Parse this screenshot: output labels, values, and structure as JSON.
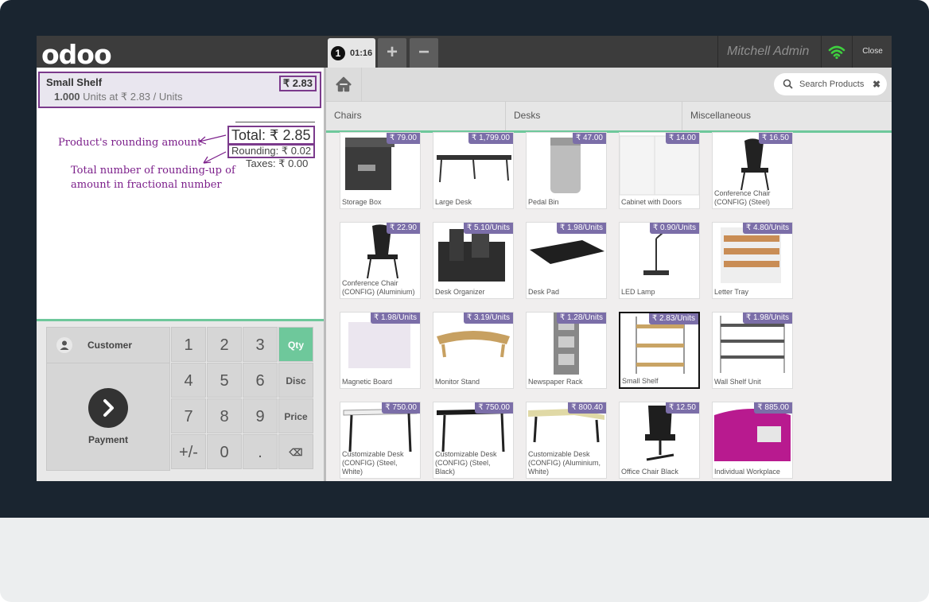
{
  "brand": {
    "logo": "odoo"
  },
  "header": {
    "order_number": "1",
    "order_time": "01:16",
    "add_label": "+",
    "remove_label": "−",
    "user": "Mitchell Admin",
    "close_label": "Close"
  },
  "order": {
    "line": {
      "name": "Small Shelf",
      "price": "₹ 2.83",
      "qty": "1.000",
      "detail": "Units at ₹ 2.83 / Units"
    },
    "total": "Total: ₹ 2.85",
    "rounding": "Rounding: ₹ 0.02",
    "taxes": "Taxes: ₹ 0.00"
  },
  "annotations": {
    "rounding_note": "Product's rounding amount",
    "total_note_1": "Total number of rounding-up of",
    "total_note_2": "amount in fractional number"
  },
  "pad": {
    "customer": "Customer",
    "payment": "Payment",
    "keys": [
      "1",
      "2",
      "3",
      "Qty",
      "4",
      "5",
      "6",
      "Disc",
      "7",
      "8",
      "9",
      "Price",
      "+/-",
      "0",
      ".",
      "⌫"
    ],
    "accent_color": "#6ec89b"
  },
  "search": {
    "placeholder": "Search Products"
  },
  "categories": [
    "Chairs",
    "Desks",
    "Miscellaneous"
  ],
  "products": [
    {
      "name": "Storage Box",
      "price": "₹ 79.00"
    },
    {
      "name": "Large Desk",
      "price": "₹ 1,799.00"
    },
    {
      "name": "Pedal Bin",
      "price": "₹ 47.00"
    },
    {
      "name": "Cabinet with Doors",
      "price": "₹ 14.00"
    },
    {
      "name": "Conference Chair (CONFIG) (Steel)",
      "price": "₹ 16.50"
    },
    {
      "name": "Conference Chair (CONFIG) (Aluminium)",
      "price": "₹ 22.90"
    },
    {
      "name": "Desk Organizer",
      "price": "₹ 5.10/Units"
    },
    {
      "name": "Desk Pad",
      "price": "₹ 1.98/Units"
    },
    {
      "name": "LED Lamp",
      "price": "₹ 0.90/Units"
    },
    {
      "name": "Letter Tray",
      "price": "₹ 4.80/Units"
    },
    {
      "name": "Magnetic Board",
      "price": "₹ 1.98/Units"
    },
    {
      "name": "Monitor Stand",
      "price": "₹ 3.19/Units"
    },
    {
      "name": "Newspaper Rack",
      "price": "₹ 1.28/Units"
    },
    {
      "name": "Small Shelf",
      "price": "₹ 2.83/Units"
    },
    {
      "name": "Wall Shelf Unit",
      "price": "₹ 1.98/Units"
    },
    {
      "name": "Customizable Desk (CONFIG) (Steel, White)",
      "price": "₹ 750.00"
    },
    {
      "name": "Customizable Desk (CONFIG) (Steel, Black)",
      "price": "₹ 750.00"
    },
    {
      "name": "Customizable Desk (CONFIG) (Aluminium, White)",
      "price": "₹ 800.40"
    },
    {
      "name": "Office Chair Black",
      "price": "₹ 12.50"
    },
    {
      "name": "Individual Workplace",
      "price": "₹ 885.00"
    }
  ],
  "colors": {
    "price_badge": "#7b6ea8",
    "annotation": "#7b1e8a",
    "highlight_box": "#7b3a8c"
  }
}
